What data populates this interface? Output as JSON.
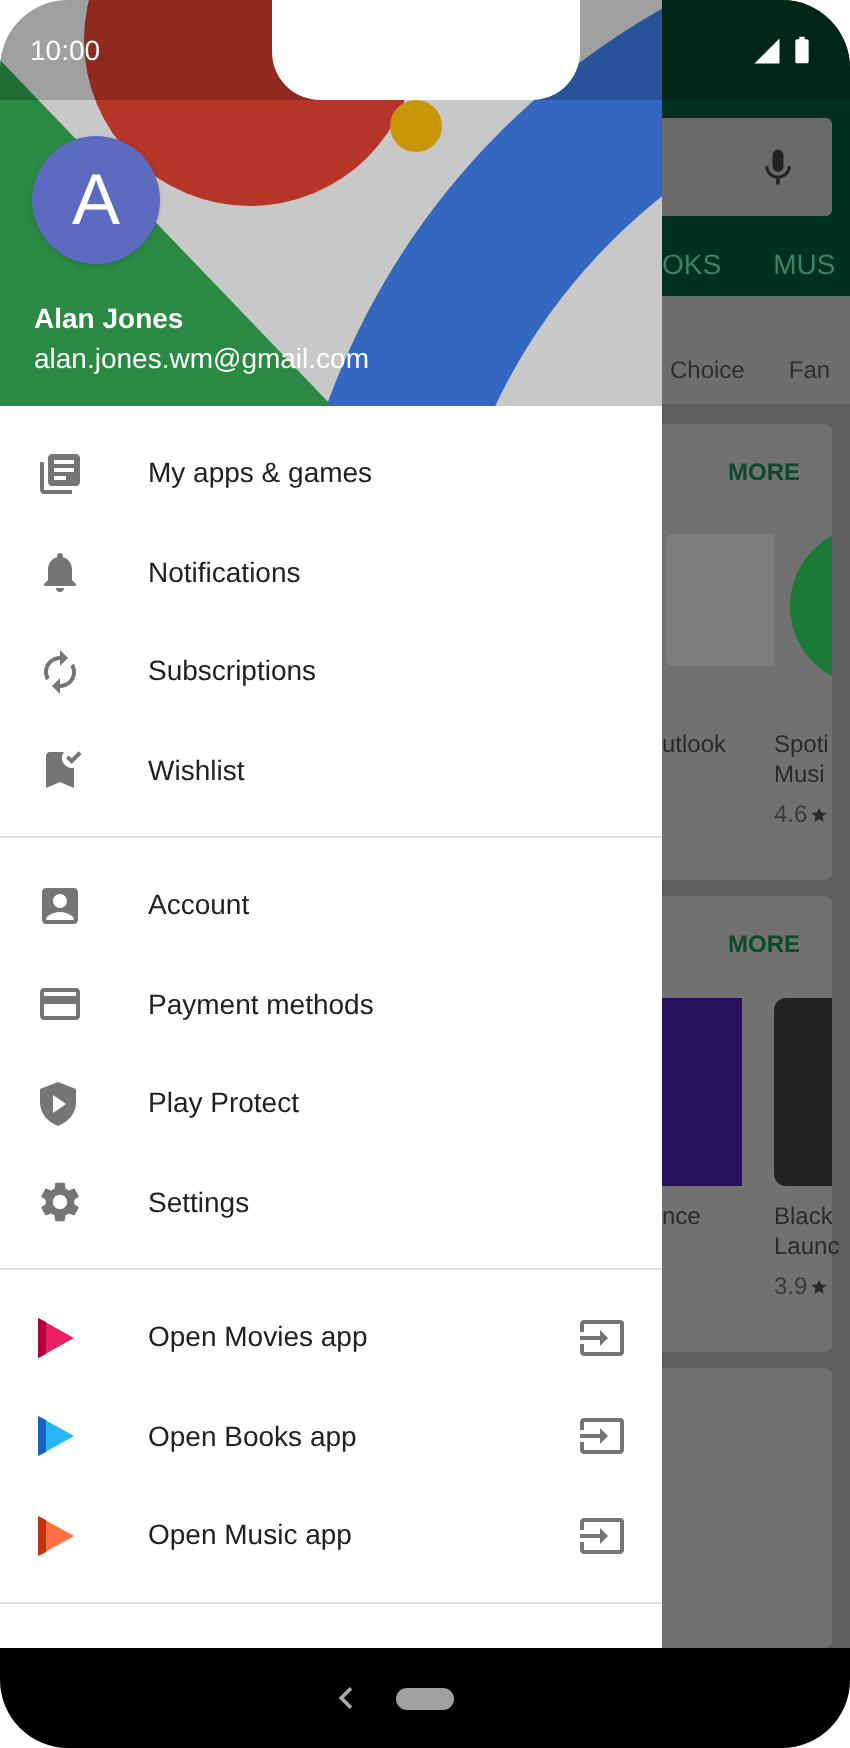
{
  "status_bar": {
    "time": "10:00"
  },
  "drawer": {
    "profile": {
      "initial": "A",
      "name": "Alan Jones",
      "email": "alan.jones.wm@gmail.com"
    },
    "groups": [
      [
        {
          "label": "My apps & games",
          "kind": "menu"
        },
        {
          "label": "Notifications",
          "kind": "menu"
        },
        {
          "label": "Subscriptions",
          "kind": "menu"
        },
        {
          "label": "Wishlist",
          "kind": "menu"
        }
      ],
      [
        {
          "label": "Account",
          "kind": "menu"
        },
        {
          "label": "Payment methods",
          "kind": "menu"
        },
        {
          "label": "Play Protect",
          "kind": "menu"
        },
        {
          "label": "Settings",
          "kind": "menu"
        }
      ],
      [
        {
          "label": "Open Movies app",
          "kind": "app_link"
        },
        {
          "label": "Open Books app",
          "kind": "app_link"
        },
        {
          "label": "Open Music app",
          "kind": "app_link"
        }
      ]
    ]
  },
  "background_app": {
    "tabs": [
      "OKS",
      "MUS"
    ],
    "chips": [
      "Choice",
      "Fan"
    ],
    "sections": [
      {
        "more": "MORE",
        "apps": [
          {
            "title": [
              "utlook"
            ]
          },
          {
            "title": [
              "Spoti",
              "Musi"
            ],
            "rating": "4.6"
          }
        ]
      },
      {
        "more": "MORE",
        "apps": [
          {
            "title": [
              "nce"
            ]
          },
          {
            "title": [
              "Black",
              "Launc"
            ],
            "rating": "3.9"
          }
        ]
      }
    ]
  }
}
